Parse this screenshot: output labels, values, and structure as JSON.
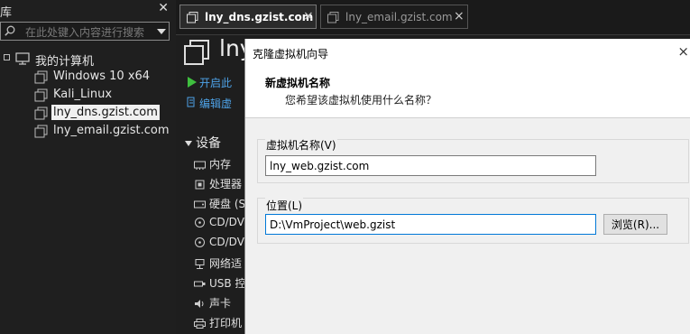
{
  "sidebar": {
    "title": "库",
    "search_placeholder": "在此处键入内容进行搜索",
    "root_label": "我的计算机",
    "vms": [
      {
        "label": "Windows 10 x64"
      },
      {
        "label": "Kali_Linux"
      },
      {
        "label": "lny_dns.gzist.com",
        "selected": true
      },
      {
        "label": "lny_email.gzist.com"
      }
    ]
  },
  "tabs": [
    {
      "label": "lny_dns.gzist.com",
      "active": true
    },
    {
      "label": "lny_email.gzist.com",
      "active": false
    }
  ],
  "vm_panel": {
    "title": "lny",
    "start_action": "开启此",
    "edit_action": "编辑虚",
    "devices_header": "设备",
    "devices": [
      {
        "label": "内存",
        "icon": "memory-icon"
      },
      {
        "label": "处理器",
        "icon": "cpu-icon"
      },
      {
        "label": "硬盘 (S",
        "icon": "harddisk-icon"
      },
      {
        "label": "CD/DV",
        "icon": "cd-icon"
      },
      {
        "label": "CD/DV",
        "icon": "cd-icon"
      },
      {
        "label": "网络适",
        "icon": "network-icon"
      },
      {
        "label": "USB 控",
        "icon": "usb-icon"
      },
      {
        "label": "声卡",
        "icon": "sound-icon"
      },
      {
        "label": "打印机",
        "icon": "printer-icon"
      }
    ]
  },
  "dialog": {
    "title": "克隆虚拟机向导",
    "close_glyph": "×",
    "heading": "新虚拟机名称",
    "subheading": "您希望该虚拟机使用什么名称？",
    "name_label": "虚拟机名称(V)",
    "name_value": "lny_web.gzist.com",
    "location_label": "位置(L)",
    "location_value": "D:\\VmProject\\web.gzist",
    "browse_label": "浏览(R)..."
  },
  "colors": {
    "accent_link": "#4ea3e8",
    "play_green": "#3fbf3f",
    "focus_border": "#0078d7"
  }
}
